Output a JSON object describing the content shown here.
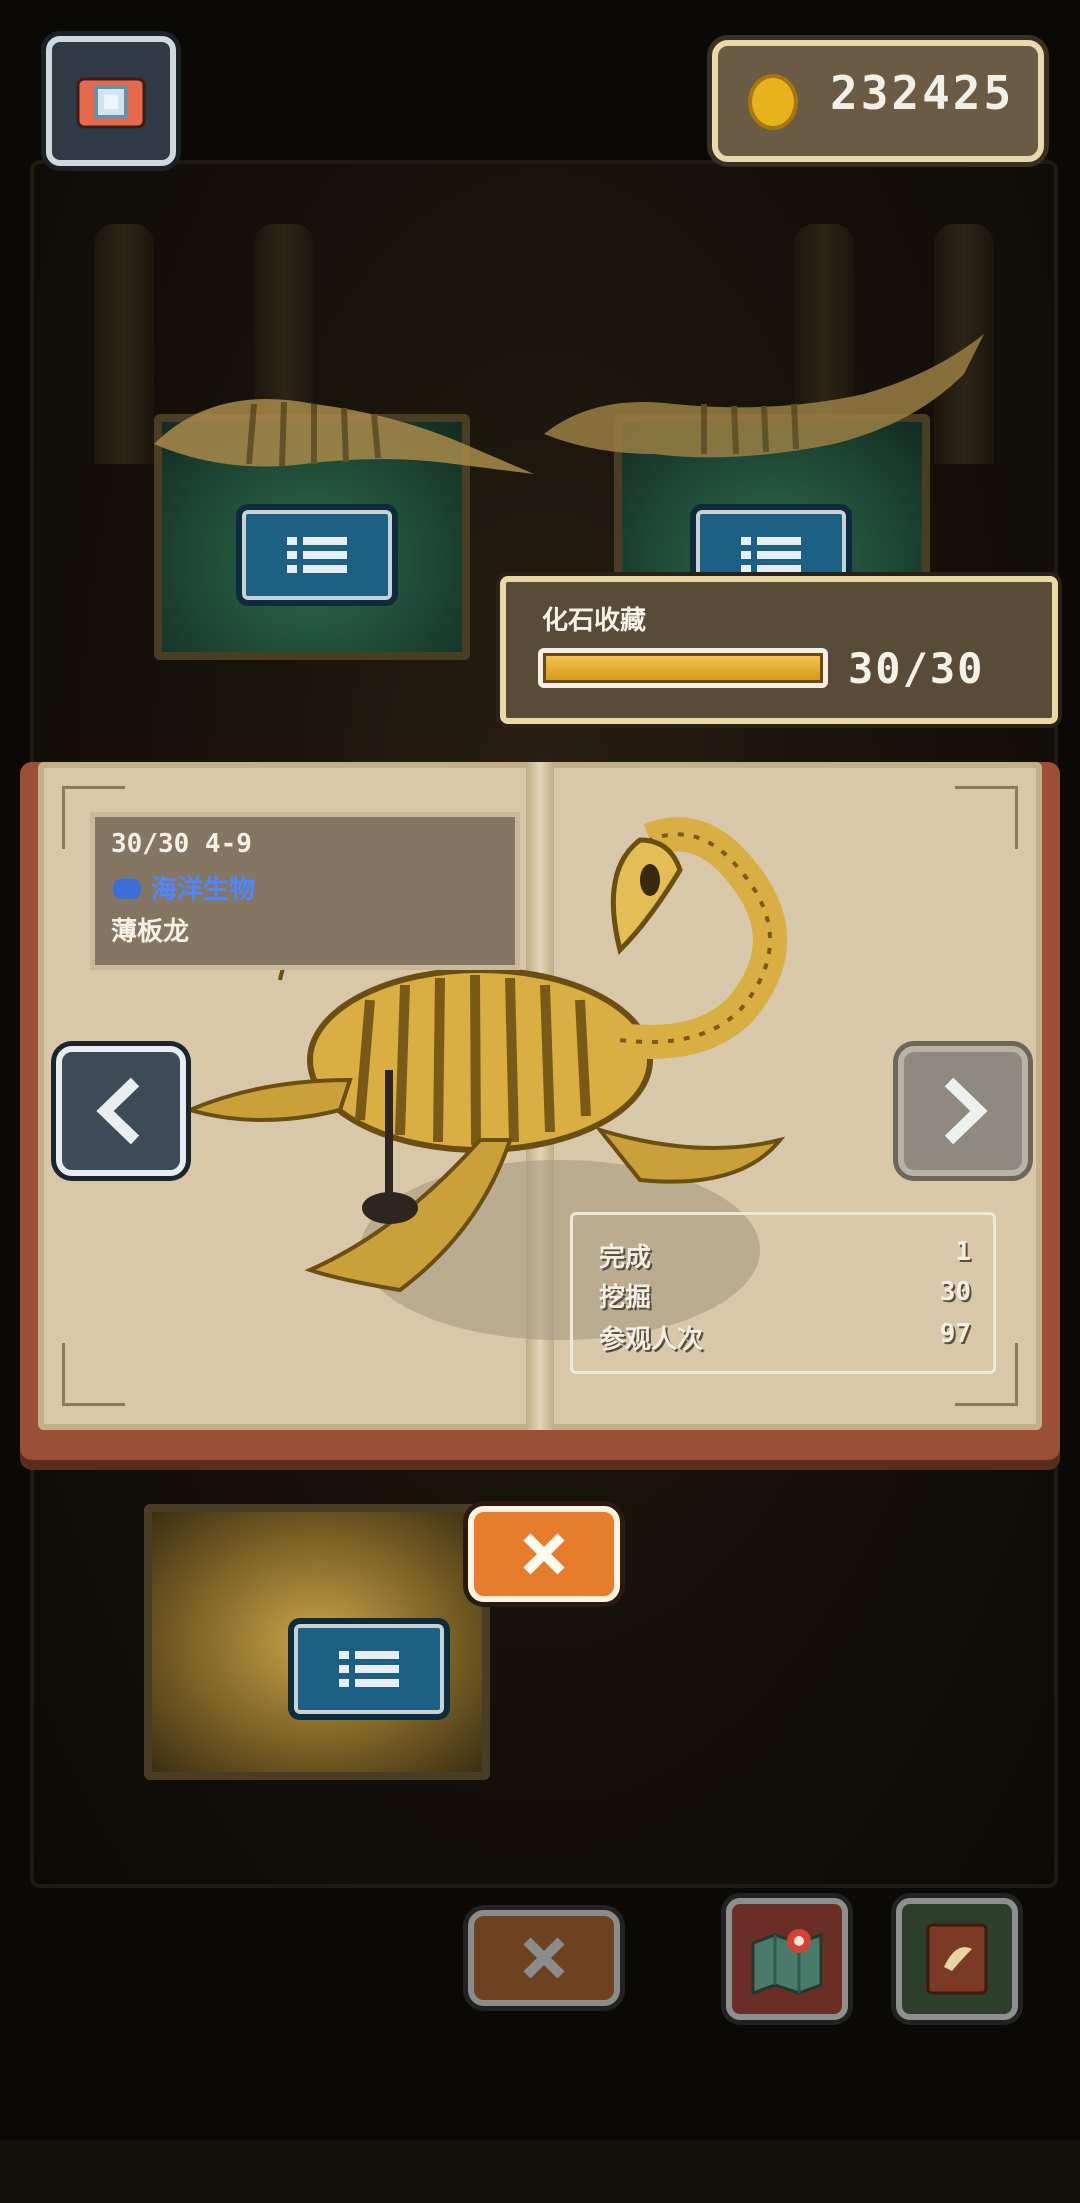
{
  "hud": {
    "camera_icon": "camera-icon",
    "coin_icon": "gold-coin-icon",
    "coins": "232425"
  },
  "collection": {
    "title": "化石收藏",
    "progress": 1.0,
    "count": "30/30"
  },
  "fossil": {
    "code": "30/30 4-9",
    "category": "海洋生物",
    "name": "薄板龙",
    "stats": [
      {
        "label": "完成",
        "value": "1"
      },
      {
        "label": "挖掘",
        "value": "30"
      },
      {
        "label": "参观人次",
        "value": "97"
      }
    ]
  },
  "colors": {
    "accent_orange": "#e67d2c",
    "category_blue": "#4f86ff",
    "progress_gold": "#f2c34d"
  }
}
